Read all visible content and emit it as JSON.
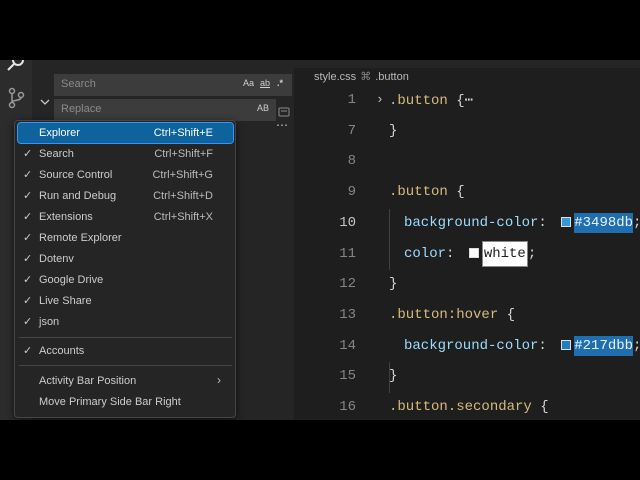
{
  "search_panel": {
    "search_placeholder": "Search",
    "replace_placeholder": "Replace",
    "match_case": "Aa",
    "whole_word": "ab",
    "regex": ".*",
    "preserve_case": "AB",
    "more": "⋯"
  },
  "breadcrumb": {
    "file": "style.css",
    "symbol": ".button"
  },
  "editor": {
    "active_line": "10",
    "lines": [
      {
        "num": "1",
        "selector": ".button",
        "rest": " {⋯"
      },
      {
        "num": "7",
        "text": "}"
      },
      {
        "num": "8",
        "text": ""
      },
      {
        "num": "9",
        "selector": ".button",
        "rest": " {"
      },
      {
        "num": "10",
        "prop": "background-color",
        "colon": ": ",
        "value": "#3498db",
        "semi": ";",
        "swatch": "#3498db"
      },
      {
        "num": "11",
        "prop": "color",
        "colon": ": ",
        "value": "white",
        "semi": ";",
        "swatch": "#ffffff"
      },
      {
        "num": "12",
        "text": "}"
      },
      {
        "num": "13",
        "selector": ".button:hover",
        "rest": " {"
      },
      {
        "num": "14",
        "prop": "background-color",
        "colon": ": ",
        "value": "#217dbb",
        "semi": ";",
        "swatch": "#217dbb"
      },
      {
        "num": "15",
        "text": "}"
      },
      {
        "num": "16",
        "selector": ".button.secondary",
        "rest": " {"
      }
    ]
  },
  "context_menu": {
    "items": [
      {
        "label": "Explorer",
        "shortcut": "Ctrl+Shift+E",
        "checked": false,
        "active": true
      },
      {
        "label": "Search",
        "shortcut": "Ctrl+Shift+F",
        "checked": true
      },
      {
        "label": "Source Control",
        "shortcut": "Ctrl+Shift+G",
        "checked": true
      },
      {
        "label": "Run and Debug",
        "shortcut": "Ctrl+Shift+D",
        "checked": true
      },
      {
        "label": "Extensions",
        "shortcut": "Ctrl+Shift+X",
        "checked": true
      },
      {
        "label": "Remote Explorer",
        "shortcut": "",
        "checked": true
      },
      {
        "label": "Dotenv",
        "shortcut": "",
        "checked": true
      },
      {
        "label": "Google Drive",
        "shortcut": "",
        "checked": true
      },
      {
        "label": "Live Share",
        "shortcut": "",
        "checked": true
      },
      {
        "label": "json",
        "shortcut": "",
        "checked": true
      }
    ],
    "accounts": {
      "label": "Accounts",
      "checked": true
    },
    "activity_bar_position": "Activity Bar Position",
    "move_sidebar": "Move Primary Side Bar Right",
    "check_glyph": "✓",
    "submenu_arrow": "›"
  },
  "icons": [
    "search-icon",
    "source-control-icon",
    "chevron-down-icon",
    "files-icon",
    "extensions-icon"
  ],
  "colors": {
    "accent": "#0e639c",
    "hex_highlight": "#1f6fb0",
    "selector": "#d7ba7d",
    "property": "#9cdcfe"
  }
}
